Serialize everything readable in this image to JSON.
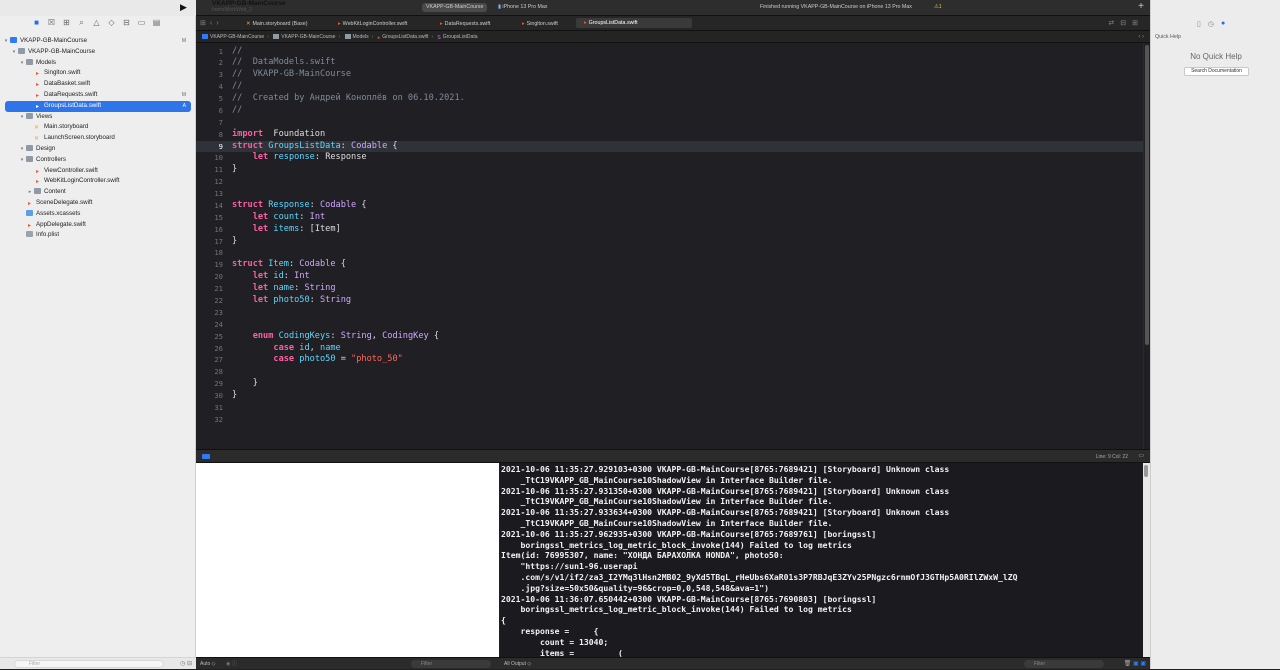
{
  "toolbar": {
    "scheme_title": "VKAPP-GB-MainCourse",
    "scheme_subtitle": "homeWorkWeb_2",
    "target_scheme": "VKAPP-GB-MainCourse",
    "device": "iPhone 13 Pro Max",
    "status": "Finished running VKAPP-GB-MainCourse on iPhone 13 Pro Max",
    "warning_count": "1"
  },
  "tabs": [
    {
      "label": "Main.storyboard (Base)"
    },
    {
      "label": "WebKitLoginController.swift"
    },
    {
      "label": "DataRequests.swift"
    },
    {
      "label": "Singlton.swift"
    },
    {
      "label": "GroupsListData.swift"
    }
  ],
  "breadcrumb": [
    "VKAPP-GB-MainCourse",
    "VKAPP-GB-MainCourse",
    "Models",
    "GroupsListData.swift",
    "GroupsListData"
  ],
  "navigator": {
    "items": [
      {
        "label": "VKAPP-GB-MainCourse",
        "badge": "M",
        "depth": 0,
        "type": "proj",
        "disc": "▾"
      },
      {
        "label": "VKAPP-GB-MainCourse",
        "badge": "",
        "depth": 1,
        "type": "folder",
        "disc": "▾"
      },
      {
        "label": "Models",
        "badge": "",
        "depth": 2,
        "type": "folder",
        "disc": "▾"
      },
      {
        "label": "Singlton.swift",
        "badge": "",
        "depth": 3,
        "type": "swift",
        "disc": ""
      },
      {
        "label": "DataBasket.swift",
        "badge": "",
        "depth": 3,
        "type": "swift",
        "disc": ""
      },
      {
        "label": "DataRequests.swift",
        "badge": "M",
        "depth": 3,
        "type": "swift",
        "disc": ""
      },
      {
        "label": "GroupsListData.swift",
        "badge": "A",
        "depth": 3,
        "type": "swift",
        "disc": "",
        "selected": true
      },
      {
        "label": "Views",
        "badge": "",
        "depth": 2,
        "type": "folder",
        "disc": "▾"
      },
      {
        "label": "Main.storyboard",
        "badge": "",
        "depth": 3,
        "type": "story",
        "disc": ""
      },
      {
        "label": "LaunchScreen.storyboard",
        "badge": "",
        "depth": 3,
        "type": "story",
        "disc": ""
      },
      {
        "label": "Design",
        "badge": "",
        "depth": 2,
        "type": "folder",
        "disc": "▾"
      },
      {
        "label": "Controllers",
        "badge": "",
        "depth": 2,
        "type": "folder",
        "disc": "▾"
      },
      {
        "label": "ViewController.swift",
        "badge": "",
        "depth": 3,
        "type": "swift",
        "disc": ""
      },
      {
        "label": "WebKitLoginController.swift",
        "badge": "",
        "depth": 3,
        "type": "swift",
        "disc": ""
      },
      {
        "label": "Content",
        "badge": "",
        "depth": 3,
        "type": "folder",
        "disc": "▸"
      },
      {
        "label": "SceneDelegate.swift",
        "badge": "",
        "depth": 2,
        "type": "swift",
        "disc": ""
      },
      {
        "label": "Assets.xcassets",
        "badge": "",
        "depth": 2,
        "type": "asset",
        "disc": ""
      },
      {
        "label": "AppDelegate.swift",
        "badge": "",
        "depth": 2,
        "type": "swift",
        "disc": ""
      },
      {
        "label": "Info.plist",
        "badge": "",
        "depth": 2,
        "type": "plist",
        "disc": ""
      }
    ],
    "filter_placeholder": "Filter"
  },
  "editor": {
    "current_line": 9,
    "lines": [
      [
        [
          "cm",
          "//"
        ]
      ],
      [
        [
          "cm",
          "//  DataModels.swift"
        ]
      ],
      [
        [
          "cm",
          "//  VKAPP-GB-MainCourse"
        ]
      ],
      [
        [
          "cm",
          "//"
        ]
      ],
      [
        [
          "cm",
          "//  Created by Андрей Коноплёв on 06.10.2021."
        ]
      ],
      [
        [
          "cm",
          "//"
        ]
      ],
      [],
      [
        [
          "kw",
          "import"
        ],
        [
          "",
          "  Foundation"
        ]
      ],
      [
        [
          "kw",
          "struct"
        ],
        [
          "",
          " "
        ],
        [
          "tp",
          "GroupsListData"
        ],
        [
          "",
          ": "
        ],
        [
          "ty",
          "Codable"
        ],
        [
          "",
          " {"
        ]
      ],
      [
        [
          "",
          "    "
        ],
        [
          "kw",
          "let"
        ],
        [
          "",
          " "
        ],
        [
          "tp",
          "response"
        ],
        [
          "",
          ": "
        ],
        [
          "",
          "Response"
        ]
      ],
      [
        [
          "",
          "}"
        ]
      ],
      [],
      [],
      [
        [
          "kw",
          "struct"
        ],
        [
          "",
          " "
        ],
        [
          "tp",
          "Response"
        ],
        [
          "",
          ": "
        ],
        [
          "ty",
          "Codable"
        ],
        [
          "",
          " {"
        ]
      ],
      [
        [
          "",
          "    "
        ],
        [
          "kw",
          "let"
        ],
        [
          "",
          " "
        ],
        [
          "tp",
          "count"
        ],
        [
          "",
          ": "
        ],
        [
          "ty",
          "Int"
        ]
      ],
      [
        [
          "",
          "    "
        ],
        [
          "kw",
          "let"
        ],
        [
          "",
          " "
        ],
        [
          "tp",
          "items"
        ],
        [
          "",
          ": ["
        ],
        [
          "",
          "Item"
        ],
        [
          "",
          "]"
        ]
      ],
      [
        [
          "",
          "}"
        ]
      ],
      [],
      [
        [
          "kw",
          "struct"
        ],
        [
          "",
          " "
        ],
        [
          "tp",
          "Item"
        ],
        [
          "",
          ": "
        ],
        [
          "ty",
          "Codable"
        ],
        [
          "",
          " {"
        ]
      ],
      [
        [
          "",
          "    "
        ],
        [
          "kw",
          "let"
        ],
        [
          "",
          " "
        ],
        [
          "tp",
          "id"
        ],
        [
          "",
          ": "
        ],
        [
          "ty",
          "Int"
        ]
      ],
      [
        [
          "",
          "    "
        ],
        [
          "kw",
          "let"
        ],
        [
          "",
          " "
        ],
        [
          "tp",
          "name"
        ],
        [
          "",
          ": "
        ],
        [
          "ty",
          "String"
        ]
      ],
      [
        [
          "",
          "    "
        ],
        [
          "kw",
          "let"
        ],
        [
          "",
          " "
        ],
        [
          "tp",
          "photo50"
        ],
        [
          "",
          ": "
        ],
        [
          "ty",
          "String"
        ]
      ],
      [],
      [],
      [
        [
          "",
          "    "
        ],
        [
          "kw",
          "enum"
        ],
        [
          "",
          " "
        ],
        [
          "tp",
          "CodingKeys"
        ],
        [
          "",
          ": "
        ],
        [
          "ty",
          "String"
        ],
        [
          "",
          ", "
        ],
        [
          "ty",
          "CodingKey"
        ],
        [
          "",
          " {"
        ]
      ],
      [
        [
          "",
          "        "
        ],
        [
          "kw",
          "case"
        ],
        [
          "",
          " "
        ],
        [
          "tp",
          "id"
        ],
        [
          "",
          ", "
        ],
        [
          "tp",
          "name"
        ]
      ],
      [
        [
          "",
          "        "
        ],
        [
          "kw",
          "case"
        ],
        [
          "",
          " "
        ],
        [
          "tp",
          "photo50"
        ],
        [
          "",
          " = "
        ],
        [
          "st",
          "\"photo_50\""
        ]
      ],
      [],
      [
        [
          "",
          "    }"
        ]
      ],
      [
        [
          "",
          "}"
        ]
      ],
      [],
      []
    ]
  },
  "status_bar": {
    "position": "Line: 9  Col: 22"
  },
  "console": {
    "lines": [
      "2021-10-06 11:35:27.929103+0300 VKAPP-GB-MainCourse[8765:7689421] [Storyboard] Unknown class",
      "    _TtC19VKAPP_GB_MainCourse10ShadowView in Interface Builder file.",
      "2021-10-06 11:35:27.931350+0300 VKAPP-GB-MainCourse[8765:7689421] [Storyboard] Unknown class",
      "    _TtC19VKAPP_GB_MainCourse10ShadowView in Interface Builder file.",
      "2021-10-06 11:35:27.933634+0300 VKAPP-GB-MainCourse[8765:7689421] [Storyboard] Unknown class",
      "    _TtC19VKAPP_GB_MainCourse10ShadowView in Interface Builder file.",
      "2021-10-06 11:35:27.962935+0300 VKAPP-GB-MainCourse[8765:7689761] [boringssl]",
      "    boringssl_metrics_log_metric_block_invoke(144) Failed to log metrics",
      "Item(id: 76995307, name: \"ХОНДА БАРАХОЛКА HONDA\", photo50:",
      "    \"https://sun1-96.userapi",
      "    .com/s/v1/if2/za3_I2YMq3lHsn2MB02_9yXd5TBqL_rHeUbs6XaR01s3P7RBJqE3ZYv25PNgzc6rnmOfJ3GTHp5A0RIlZWxW_lZQ",
      "    .jpg?size=50x50&quality=96&crop=0,0,548,548&ava=1\")",
      "2021-10-06 11:36:07.650442+0300 VKAPP-GB-MainCourse[8765:7690803] [boringssl]",
      "    boringssl_metrics_log_metric_block_invoke(144) Failed to log metrics",
      "{",
      "    response =     {",
      "        count = 13040;",
      "        items =         ("
    ]
  },
  "debug_bar": {
    "auto_label": "Auto ◇",
    "filter_placeholder": "Filter",
    "output_label": "All Output ◇",
    "console_filter_placeholder": "Filter"
  },
  "inspector": {
    "title": "Quick Help",
    "empty_text": "No Quick Help",
    "search_button": "Search Documentation"
  }
}
